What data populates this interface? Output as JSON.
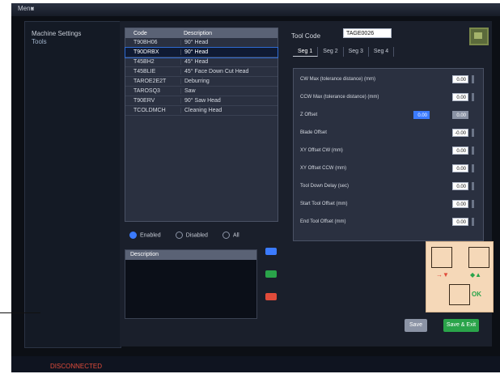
{
  "menu": {
    "label": "Menu",
    "caret": "▾"
  },
  "nav": {
    "items": [
      "Machine Settings",
      "Tools"
    ]
  },
  "tools_table": {
    "headers": [
      "Code",
      "Description"
    ],
    "rows": [
      {
        "code": "T90BH06",
        "desc": "90° Head",
        "selected": false
      },
      {
        "code": "T90DRBX",
        "desc": "90° Head",
        "selected": true
      },
      {
        "code": "T45BH2",
        "desc": "45° Head",
        "selected": false
      },
      {
        "code": "T45BLIE",
        "desc": "45° Face Down Cut Head",
        "selected": false
      },
      {
        "code": "TAROE2E2T",
        "desc": "Deburring",
        "selected": false
      },
      {
        "code": "TAROSQ3",
        "desc": "Saw",
        "selected": false
      },
      {
        "code": "T90ERV",
        "desc": "90° Saw Head",
        "selected": false
      },
      {
        "code": "TCOLDMCH",
        "desc": "Cleaning Head",
        "selected": false
      }
    ]
  },
  "filters": {
    "options": [
      "Enabled",
      "Disabled",
      "All"
    ],
    "selected": "Enabled"
  },
  "description_panel": {
    "header": "Description"
  },
  "tool_code": {
    "label": "Tool Code",
    "value": "TAGE0026"
  },
  "tabs": [
    "Seg 1",
    "Seg 2",
    "Seg 3",
    "Seg 4"
  ],
  "parameters": [
    {
      "label": "CW Max (tolerance distance) (mm)",
      "value": "0.00"
    },
    {
      "label": "CCW Max (tolerance distance) (mm)",
      "value": "0.00"
    },
    {
      "label": "Z Offset",
      "value": "0.00"
    },
    {
      "label": "Blade Offset",
      "value": "-0.00"
    },
    {
      "label": "XY Offset CW (mm)",
      "value": "0.00"
    },
    {
      "label": "XY Offset CCW (mm)",
      "value": "0.00"
    },
    {
      "label": "Tool Down Delay (sec)",
      "value": "0.00"
    },
    {
      "label": "Start Tool Offset (mm)",
      "value": "0.00"
    },
    {
      "label": "End Tool Offset (mm)",
      "value": "0.00"
    }
  ],
  "z_offset_extra": {
    "value": "0.00"
  },
  "actions": {
    "primary": "Save & Exit",
    "secondary": "Save"
  },
  "status": {
    "text": "DISCONNECTED"
  },
  "colors": {
    "accent": "#3b7bff",
    "ok": "#2aa44a",
    "error": "#e04b3a"
  },
  "icons": {
    "corner": "settings-icon",
    "jog": "jog-pad-icon"
  },
  "jog": {
    "ok_label": "OK"
  }
}
